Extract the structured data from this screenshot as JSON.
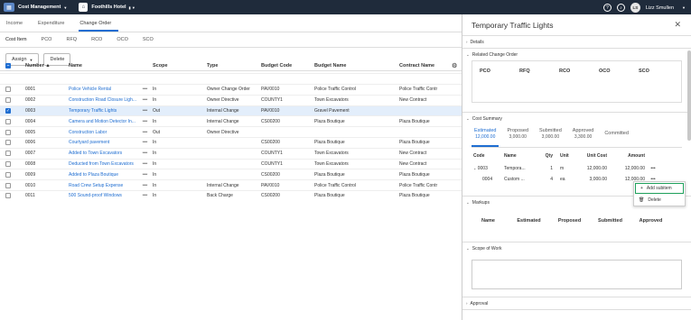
{
  "topbar": {
    "app_name": "Cost Management",
    "project_name": "Foothills Hotel",
    "help_icon": "?",
    "user_initials": "LS",
    "user_name": "Lizz Smullen"
  },
  "main_tabs": [
    "Income",
    "Expenditure",
    "Change Order"
  ],
  "sub_tabs": [
    "Cost Item",
    "PCO",
    "RFQ",
    "RCO",
    "OCO",
    "SCO"
  ],
  "toolbar": {
    "assign_label": "Assign",
    "delete_label": "Delete"
  },
  "grid": {
    "headers": {
      "number": "Number",
      "name": "Name",
      "scope": "Scope",
      "type": "Type",
      "budget_code": "Budget Code",
      "budget_name": "Budget Name",
      "contract_name": "Contract Name"
    },
    "rows": [
      {
        "number": "0001",
        "name": "Police Vehicle Rental",
        "scope": "In",
        "type": "Owner Change Order",
        "budget_code": "PAV0010",
        "budget_name": "Police Traffic Control",
        "contract_name": "Police Traffic Contr",
        "checked": false
      },
      {
        "number": "0002",
        "name": "Construction Road Closure Ligh...",
        "scope": "In",
        "type": "Owner Directive",
        "budget_code": "COUNTY1",
        "budget_name": "Town Excavators",
        "contract_name": "New Contract",
        "checked": false
      },
      {
        "number": "0003",
        "name": "Temporary Traffic Lights",
        "scope": "Out",
        "type": "Internal Change",
        "budget_code": "PAV0010",
        "budget_name": "Gravel Pavement",
        "contract_name": "",
        "checked": true
      },
      {
        "number": "0004",
        "name": "Camera and Motion Detector In...",
        "scope": "In",
        "type": "Internal Change",
        "budget_code": "CS00200",
        "budget_name": "Plaza Boutique",
        "contract_name": "Plaza Boutique",
        "checked": false
      },
      {
        "number": "0005",
        "name": "Construction Labor",
        "scope": "Out",
        "type": "Owner Directive",
        "budget_code": "",
        "budget_name": "",
        "contract_name": "",
        "checked": false
      },
      {
        "number": "0006",
        "name": "Courtyard pavement",
        "scope": "In",
        "type": "",
        "budget_code": "CS00200",
        "budget_name": "Plaza Boutique",
        "contract_name": "Plaza Boutique",
        "checked": false
      },
      {
        "number": "0007",
        "name": "Added to Town Excavators",
        "scope": "In",
        "type": "",
        "budget_code": "COUNTY1",
        "budget_name": "Town Excavators",
        "contract_name": "New Contract",
        "checked": false
      },
      {
        "number": "0008",
        "name": "Deducted from Town Excavators",
        "scope": "In",
        "type": "",
        "budget_code": "COUNTY1",
        "budget_name": "Town Excavators",
        "contract_name": "New Contract",
        "checked": false
      },
      {
        "number": "0009",
        "name": "Added to Plaza Boutique",
        "scope": "In",
        "type": "",
        "budget_code": "CS00200",
        "budget_name": "Plaza Boutique",
        "contract_name": "Plaza Boutique",
        "checked": false
      },
      {
        "number": "0010",
        "name": "Road Crew Setup Expense",
        "scope": "In",
        "type": "Internal Change",
        "budget_code": "PAV0010",
        "budget_name": "Police Traffic Control",
        "contract_name": "Police Traffic Contr",
        "checked": false
      },
      {
        "number": "0011",
        "name": "500 Sound-proof Windows",
        "scope": "In",
        "type": "Back Charge",
        "budget_code": "CS00200",
        "budget_name": "Plaza Boutique",
        "contract_name": "Plaza Boutique",
        "checked": false
      }
    ]
  },
  "panel": {
    "title": "Temporary Traffic Lights",
    "details_label": "Details",
    "related_label": "Related Change Order",
    "related_cols": [
      "PCO",
      "RFQ",
      "RCO",
      "OCO",
      "SCO"
    ],
    "cost_summary_label": "Cost Summary",
    "cost_tabs": [
      {
        "label": "Estimated",
        "value": "12,000.00"
      },
      {
        "label": "Proposed",
        "value": "3,000.00"
      },
      {
        "label": "Submitted",
        "value": "3,000.00"
      },
      {
        "label": "Approved",
        "value": "3,300.00"
      },
      {
        "label": "Committed",
        "value": ""
      }
    ],
    "cost_headers": {
      "code": "Code",
      "name": "Name",
      "qty": "Qty",
      "unit": "Unit",
      "unit_cost": "Unit Cost",
      "amount": "Amount"
    },
    "cost_rows": [
      {
        "code": "0003",
        "name": "Tempora...",
        "qty": "1",
        "unit": "m",
        "unit_cost": "12,000.00",
        "amount": "12,000.00"
      },
      {
        "code": "0004",
        "name": "Custom ...",
        "qty": "4",
        "unit": "ea",
        "unit_cost": "3,000.00",
        "amount": "12,000.00"
      }
    ],
    "context_menu": {
      "add_subitem": "Add subitem",
      "delete": "Delete"
    },
    "markups_label": "Markups",
    "markup_cols": [
      "Name",
      "Estimated",
      "Proposed",
      "Submitted",
      "Approved"
    ],
    "scope_label": "Scope of Work",
    "approval_label": "Approval"
  }
}
